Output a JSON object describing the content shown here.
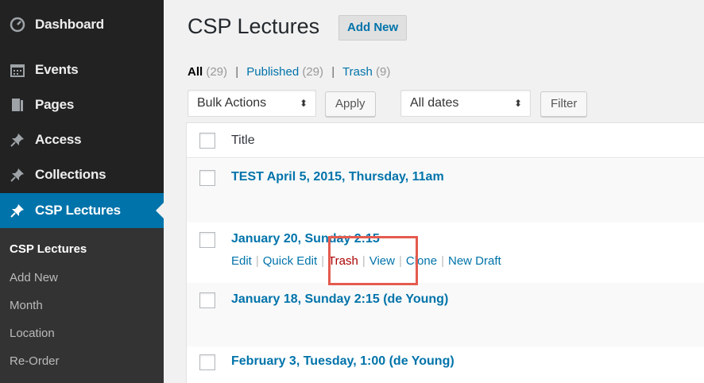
{
  "sidebar": {
    "items": [
      {
        "label": "Dashboard",
        "icon": "dashboard-icon"
      },
      {
        "label": "Events",
        "icon": "calendar-icon"
      },
      {
        "label": "Pages",
        "icon": "pages-icon"
      },
      {
        "label": "Access",
        "icon": "pin-icon"
      },
      {
        "label": "Collections",
        "icon": "pin-icon"
      },
      {
        "label": "CSP Lectures",
        "icon": "pin-icon",
        "active": true
      }
    ],
    "submenu": [
      "CSP Lectures",
      "Add New",
      "Month",
      "Location",
      "Re-Order"
    ]
  },
  "header": {
    "title": "CSP Lectures",
    "add_new": "Add New"
  },
  "filters": {
    "all_label": "All",
    "all_count": "(29)",
    "published_label": "Published",
    "published_count": "(29)",
    "trash_label": "Trash",
    "trash_count": "(9)",
    "bulk_actions": "Bulk Actions",
    "apply": "Apply",
    "dates": "All dates",
    "filter": "Filter"
  },
  "table": {
    "header_title": "Title",
    "rows": [
      {
        "title": "TEST April 5, 2015, Thursday, 11am"
      },
      {
        "title": "January 20, Sunday 2:15"
      },
      {
        "title": "January 18, Sunday 2:15 (de Young)"
      },
      {
        "title": "February 3, Tuesday, 1:00 (de Young)"
      }
    ],
    "row_actions": {
      "edit": "Edit",
      "quick_edit": "Quick Edit",
      "trash": "Trash",
      "view": "View",
      "clone": "Clone",
      "new_draft": "New Draft"
    }
  },
  "colors": {
    "accent": "#0073aa",
    "trash": "#aa0000",
    "highlight": "#e45b4f",
    "sidebar_bg": "#222222"
  }
}
